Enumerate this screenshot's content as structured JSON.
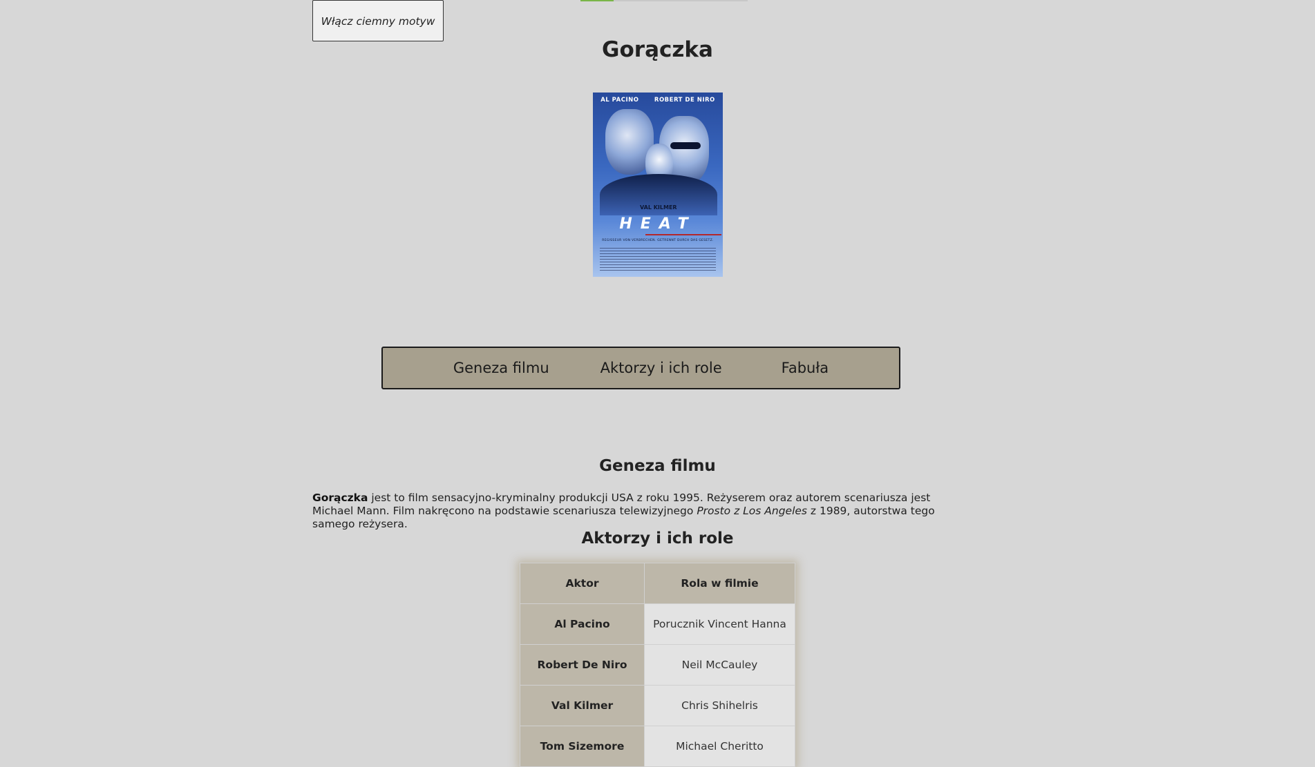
{
  "progress": {
    "value_percent": 20,
    "color": "#7ab648"
  },
  "theme_button": {
    "label": "Włącz ciemny motyw"
  },
  "page": {
    "title": "Gorączka"
  },
  "poster": {
    "actor_left": "AL PACINO",
    "actor_right": "ROBERT DE NIRO",
    "actor_bottom": "VAL KILMER",
    "movie_title": "HEAT",
    "tagline": "REGISSEUR VON VERBRECHEN. GETRENNT DURCH DAS GESETZ."
  },
  "nav": {
    "items": [
      {
        "label": "Geneza filmu"
      },
      {
        "label": "Aktorzy i ich role"
      },
      {
        "label": "Fabuła"
      }
    ]
  },
  "genesis": {
    "heading": "Geneza filmu",
    "bold_title": "Gorączka",
    "text_1": " jest to film sensacyjno-kryminalny produkcji USA z roku 1995. Reżyserem oraz autorem scenariusza jest Michael Mann. Film nakręcono na podstawie scenariusza telewizyjnego ",
    "italic_title": "Prosto z Los Angeles",
    "text_2": " z 1989, autorstwa tego samego reżysera."
  },
  "cast": {
    "heading": "Aktorzy i ich role",
    "headers": [
      "Aktor",
      "Rola w filmie"
    ],
    "rows": [
      {
        "actor": "Al Pacino",
        "role": "Porucznik Vincent Hanna"
      },
      {
        "actor": "Robert De Niro",
        "role": "Neil McCauley"
      },
      {
        "actor": "Val Kilmer",
        "role": "Chris Shihelris"
      },
      {
        "actor": "Tom Sizemore",
        "role": "Michael Cheritto"
      }
    ]
  },
  "colors": {
    "background": "#d7d7d7",
    "nav_background": "#a7a08e",
    "table_header": "#bdb7a9",
    "table_cell": "#e3e3e3"
  }
}
